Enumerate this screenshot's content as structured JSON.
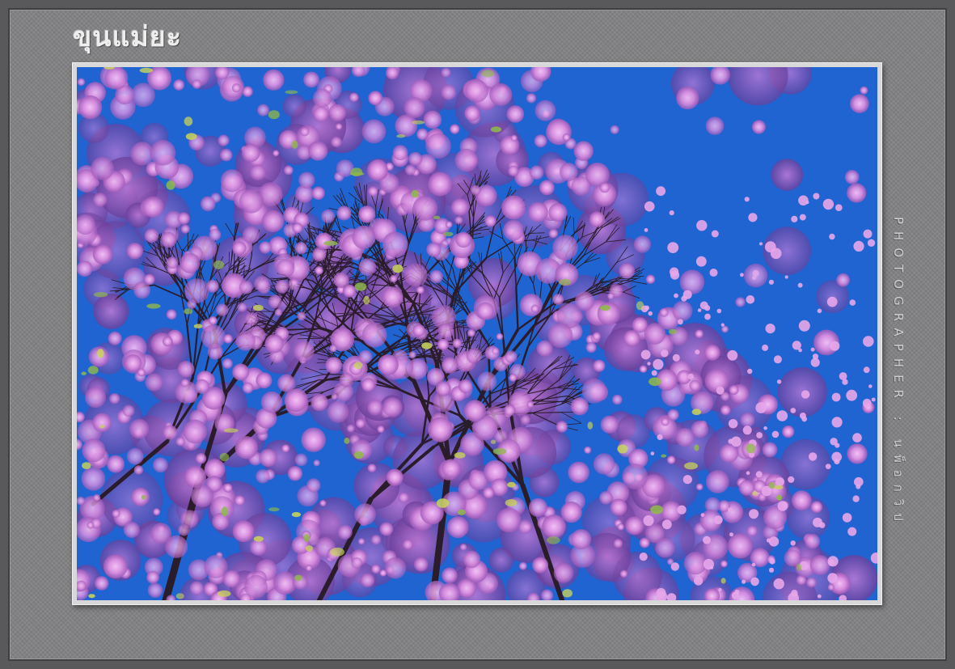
{
  "title": "ขุนแม่ยะ",
  "credit": "PHOTOGRAPHER : นพ็อกวิป",
  "colors": {
    "mat": "#828284",
    "frame": "#59595b",
    "sky": "#2064d2",
    "blossom": "#d88ee0",
    "branch": "#2a1c2a"
  },
  "photo": {
    "subject": "pink-cherry-blossom-tree",
    "background": "blue-sky"
  }
}
